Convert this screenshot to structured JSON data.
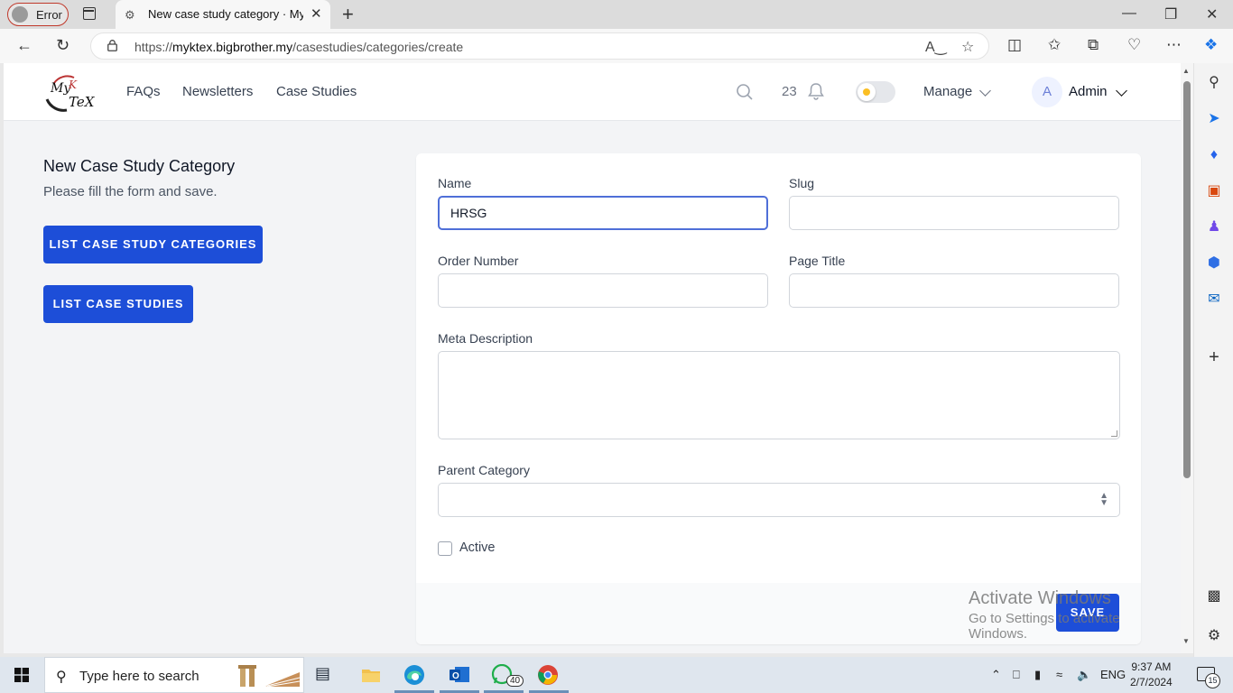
{
  "browser": {
    "profile_label": "Error",
    "tab_title": "New case study category · Myktex",
    "url_prefix": "https://",
    "url_host": "myktex.bigbrother.my",
    "url_path": "/casestudies/categories/create"
  },
  "nav": {
    "links": [
      "FAQs",
      "Newsletters",
      "Case Studies"
    ],
    "notification_count": "23",
    "manage_label": "Manage",
    "user_initial": "A",
    "user_name": "Admin"
  },
  "page": {
    "heading": "New Case Study Category",
    "subheading": "Please fill the form and save.",
    "list_categories_button": "LIST CASE STUDY CATEGORIES",
    "list_studies_button": "LIST CASE STUDIES"
  },
  "form": {
    "name_label": "Name",
    "name_value": "HRSG",
    "slug_label": "Slug",
    "slug_value": "",
    "order_label": "Order Number",
    "order_value": "",
    "page_title_label": "Page Title",
    "page_title_value": "",
    "meta_label": "Meta Description",
    "meta_value": "",
    "parent_label": "Parent Category",
    "parent_value": "",
    "active_label": "Active",
    "active_checked": false,
    "save_button": "SAVE"
  },
  "watermark": {
    "line1": "Activate Windows",
    "line2": "Go to Settings to activate Windows."
  },
  "taskbar": {
    "search_placeholder": "Type here to search",
    "whatsapp_badge": "40",
    "language": "ENG",
    "time": "9:37 AM",
    "date": "2/7/2024",
    "notification_badge": "15"
  },
  "colors": {
    "primary": "#1d4ed8",
    "focus_border": "#4f6fd8",
    "page_bg": "#f3f4f6"
  }
}
